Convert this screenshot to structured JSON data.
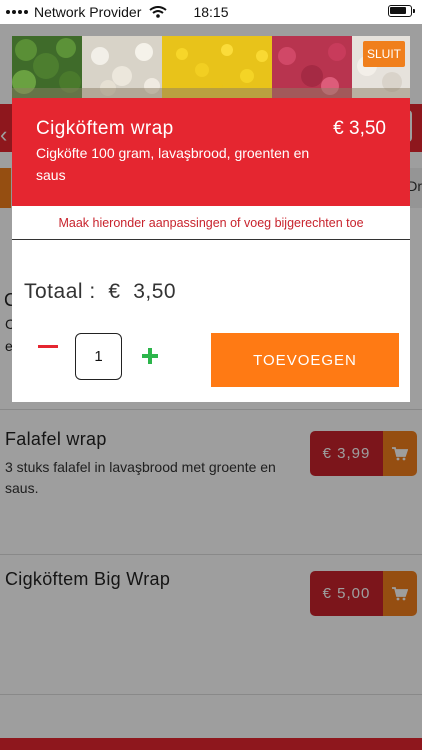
{
  "status_bar": {
    "carrier": "Network Provider",
    "time": "18:15",
    "icons": [
      "signal-dots-icon",
      "wifi-icon",
      "battery-icon"
    ]
  },
  "background_list": {
    "items": [
      {
        "name": "Falafel wrap",
        "description": "3 stuks falafel in lavaşbrood met groente en saus.",
        "price": "€ 3,99"
      },
      {
        "name": "Cigköftem Big Wrap",
        "description": "",
        "price": "€ 5,00"
      }
    ],
    "partial_tab_label": "Dr",
    "partial_item_initial": "C",
    "partial_desc_initial_1": "C",
    "partial_desc_initial_2": "e"
  },
  "modal": {
    "close_label": "SLUIT",
    "product_name": "Cigköftem wrap",
    "product_price": "€ 3,50",
    "product_description": "Cigköfte 100 gram, lavaşbrood, groenten en saus",
    "hint": "Maak hieronder aanpassingen of voeg bijgerechten toe",
    "total_label": "Totaal :  €  3,50",
    "quantity": "1",
    "add_button_label": "TOEVOEGEN"
  },
  "colors": {
    "brand_red": "#e52630",
    "accent_orange": "#f07f1c",
    "add_orange": "#ff7a14",
    "plus_green": "#2cb54b"
  }
}
